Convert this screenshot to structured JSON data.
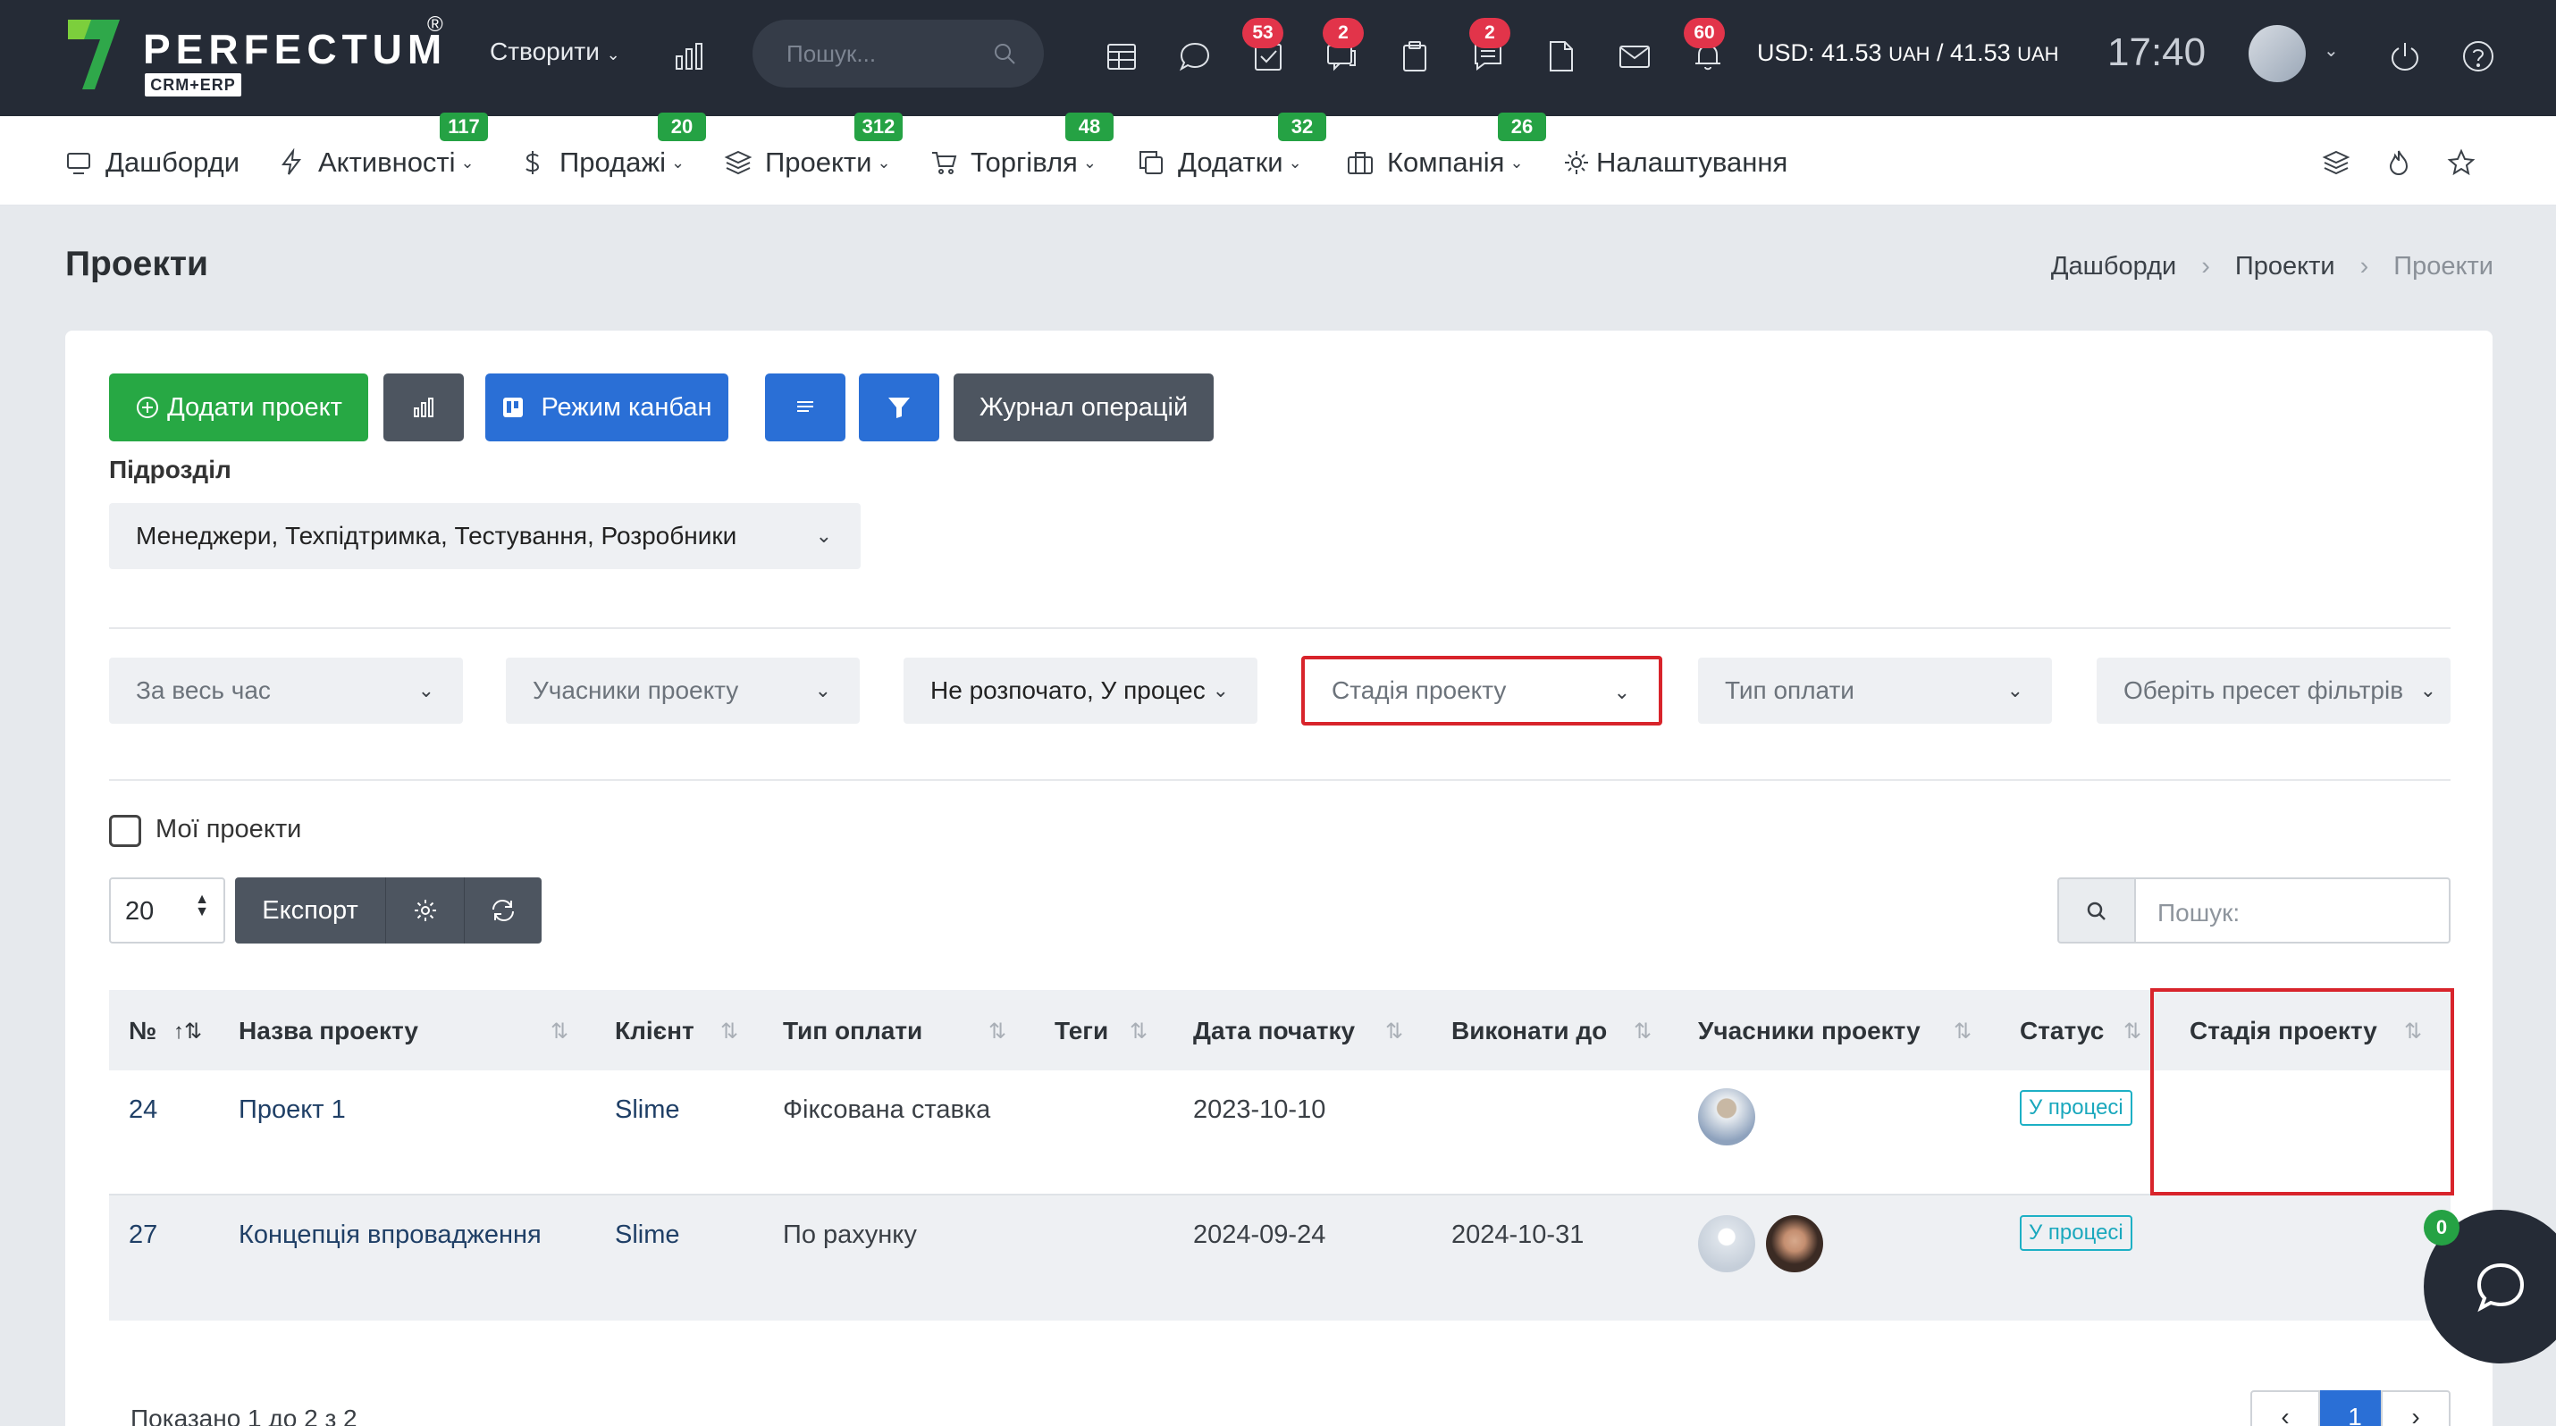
{
  "topbar": {
    "logo_text": "PERFECTUM",
    "logo_sub": "CRM+ERP",
    "logo_reg": "®",
    "create_label": "Створити",
    "search_placeholder": "Пошук...",
    "badges": {
      "tasks": "53",
      "chat": "2",
      "notes": "2",
      "notify": "60"
    },
    "rate_prefix": "USD: 41.53 ",
    "rate_unit1": "UAH",
    "rate_mid": " / 41.53 ",
    "rate_unit2": "UAH",
    "time": "17:40"
  },
  "nav": {
    "items": [
      {
        "label": "Дашборди",
        "badge": ""
      },
      {
        "label": "Активності",
        "badge": "117"
      },
      {
        "label": "Продажі",
        "badge": "20"
      },
      {
        "label": "Проекти",
        "badge": "312"
      },
      {
        "label": "Торгівля",
        "badge": "48"
      },
      {
        "label": "Додатки",
        "badge": "32"
      },
      {
        "label": "Компанія",
        "badge": "26"
      },
      {
        "label": "Налаштування",
        "badge": ""
      }
    ]
  },
  "page": {
    "title": "Проекти",
    "breadcrumb": [
      "Дашборди",
      "Проекти",
      "Проекти"
    ]
  },
  "toolbar": {
    "add_label": "Додати проект",
    "kanban_label": "Режим канбан",
    "journal_label": "Журнал операцій"
  },
  "filters": {
    "subdivision_label": "Підрозділ",
    "subdivision_value": "Менеджери, Техпідтримка, Тестування, Розробники",
    "period": "За весь час",
    "members": "Учасники проекту",
    "status_value": "Не розпочато, У процес",
    "stage": "Стадія проекту",
    "payment": "Тип оплати",
    "preset": "Оберіть пресет фільтрів",
    "my_projects": "Мої проекти"
  },
  "table_controls": {
    "page_size": "20",
    "export_label": "Експорт",
    "search_placeholder": "Пошук:"
  },
  "table": {
    "headers": [
      "№",
      "Назва проекту",
      "Клієнт",
      "Тип оплати",
      "Теги",
      "Дата початку",
      "Виконати до",
      "Учасники проекту",
      "Статус",
      "Стадія проекту"
    ],
    "rows": [
      {
        "id": "24",
        "name": "Проект 1",
        "client": "Slime",
        "payment": "Фіксована ставка",
        "tags": "",
        "start": "2023-10-10",
        "due": "",
        "status": "У процесі",
        "stage": ""
      },
      {
        "id": "27",
        "name": "Концепція впровадження",
        "client": "Slime",
        "payment": "По рахунку",
        "tags": "",
        "start": "2024-09-24",
        "due": "2024-10-31",
        "status": "У процесі",
        "stage": ""
      }
    ]
  },
  "footer": {
    "info": "Показано 1 до 2 з 2",
    "prev": "‹",
    "page": "1",
    "next": "›"
  },
  "chat": {
    "badge": "0"
  },
  "colors": {
    "topbar": "#252b36",
    "green": "#27a844",
    "blue": "#2a6fd6",
    "dark_btn": "#4d5560",
    "highlight": "#d8242b",
    "status": "#1aa8bd"
  }
}
